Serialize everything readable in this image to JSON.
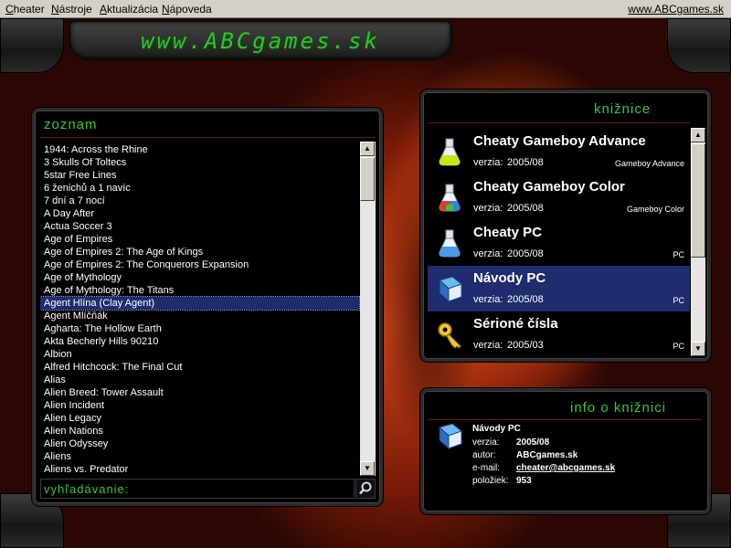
{
  "menu": {
    "items": [
      {
        "label": "Cheater"
      },
      {
        "label": "Nástroje"
      },
      {
        "label": "Aktualizácia"
      },
      {
        "label": "Nápoveda"
      }
    ],
    "site": "www.ABCgames.sk"
  },
  "header": {
    "logo_text": "www.ABCgames.sk"
  },
  "zoznam": {
    "title": "zoznam",
    "items": [
      "1944: Across the Rhine",
      "3 Skulls Of Toltecs",
      "5star Free Lines",
      "6 ženichů a 1 navíc",
      "7 dní a 7 nocí",
      "A Day After",
      "Actua Soccer 3",
      "Age of Empires",
      "Age of Empires 2: The Age of Kings",
      "Age of Empires 2: The Conquerors Expansion",
      "Age of Mythology",
      "Age of Mythology: The Titans",
      "Agent Hlína (Clay Agent)",
      "Agent Mlíčňák",
      "Agharta: The Hollow Earth",
      "Akta Becherly Hills 90210",
      "Albion",
      "Alfred Hitchcock: The Final Cut",
      "Alias",
      "Alien Breed: Tower Assault",
      "Alien Incident",
      "Alien Legacy",
      "Alien Nations",
      "Alien Odyssey",
      "Aliens",
      "Aliens vs. Predator"
    ],
    "selected_index": 12,
    "search_placeholder": "vyhľadávanie:"
  },
  "kniznice": {
    "title": "knižnice",
    "version_label": "verzia:",
    "items": [
      {
        "name": "Cheaty Gameboy Advance",
        "version": "2005/08",
        "platform": "Gameboy Advance",
        "icon": "flask-yellow-icon"
      },
      {
        "name": "Cheaty Gameboy Color",
        "version": "2005/08",
        "platform": "Gameboy Color",
        "icon": "flask-red-icon"
      },
      {
        "name": "Cheaty PC",
        "version": "2005/08",
        "platform": "PC",
        "icon": "flask-blue-icon"
      },
      {
        "name": "Návody PC",
        "version": "2005/08",
        "platform": "PC",
        "icon": "book-icon"
      },
      {
        "name": "Sérioné čísla",
        "version": "2005/03",
        "platform": "PC",
        "icon": "key-icon"
      }
    ],
    "selected_index": 3
  },
  "info": {
    "title": "info o knižnici",
    "name": "Návody PC",
    "labels": {
      "version": "verzia:",
      "author": "autor:",
      "email": "e-mail:",
      "count": "položiek:"
    },
    "version": "2005/08",
    "author": "ABCgames.sk",
    "email": "cheater@abcgames.sk",
    "count": "953"
  },
  "colors": {
    "accent_green": "#3cc73c",
    "selection": "#1f2c6e",
    "panel_bg": "#000000"
  }
}
